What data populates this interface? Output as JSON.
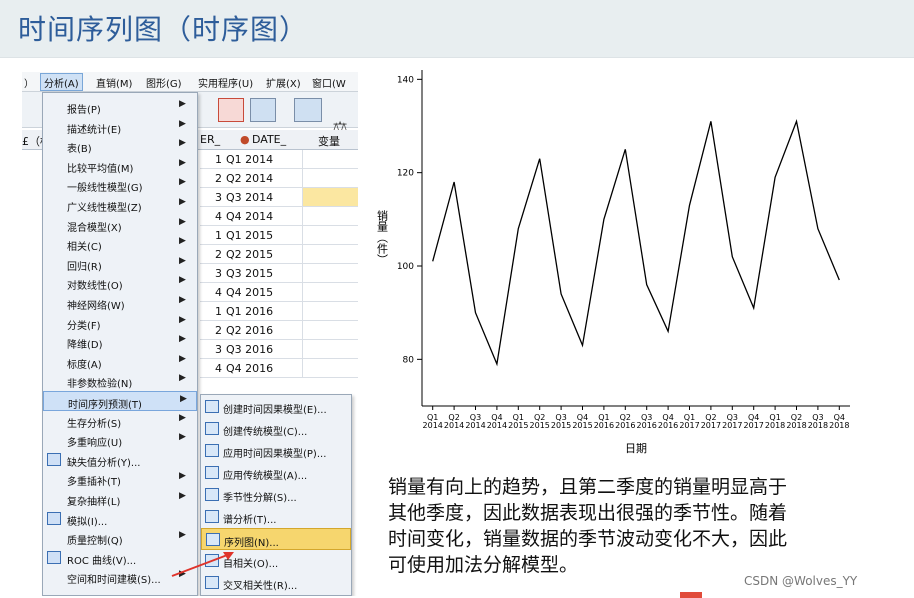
{
  "slide": {
    "title": "时间序列图（时序图）",
    "title_color": "#2e5d9a",
    "watermark": "CSDN @Wolves_YY",
    "description": [
      "销量有向上的趋势，且第二季度的销量明显高于",
      "其他季度，因此数据表现出很强的季节性。随着",
      "时间变化，销量数据的季节波动变化不大，因此",
      "可使用加法分解模型。"
    ]
  },
  "spss": {
    "menubar": [
      {
        "label": "）",
        "icon": "menu-fragment"
      },
      {
        "label": "分析(A)",
        "active": true
      },
      {
        "label": "直销(M)"
      },
      {
        "label": "图形(G)"
      },
      {
        "label": "实用程序(U)"
      },
      {
        "label": "扩展(X)"
      },
      {
        "label": "窗口(W"
      }
    ],
    "grid_headers": {
      "left_fragment": "£（标",
      "er": "ER_",
      "date": "DATE_",
      "var": "变量"
    },
    "rows": [
      {
        "n": "1",
        "date": "Q1 2014"
      },
      {
        "n": "2",
        "date": "Q2 2014"
      },
      {
        "n": "3",
        "date": "Q3 2014"
      },
      {
        "n": "4",
        "date": "Q4 2014"
      },
      {
        "n": "1",
        "date": "Q1 2015"
      },
      {
        "n": "2",
        "date": "Q2 2015"
      },
      {
        "n": "3",
        "date": "Q3 2015"
      },
      {
        "n": "4",
        "date": "Q4 2015"
      },
      {
        "n": "1",
        "date": "Q1 2016"
      },
      {
        "n": "2",
        "date": "Q2 2016"
      },
      {
        "n": "3",
        "date": "Q3 2016"
      },
      {
        "n": "4",
        "date": "Q4 2016"
      }
    ],
    "analyze_menu": [
      {
        "label": "报告(P)",
        "arrow": true
      },
      {
        "label": "描述统计(E)",
        "arrow": true
      },
      {
        "label": "表(B)",
        "arrow": true
      },
      {
        "label": "比较平均值(M)",
        "arrow": true
      },
      {
        "label": "一般线性模型(G)",
        "arrow": true
      },
      {
        "label": "广义线性模型(Z)",
        "arrow": true
      },
      {
        "label": "混合模型(X)",
        "arrow": true
      },
      {
        "label": "相关(C)",
        "arrow": true
      },
      {
        "label": "回归(R)",
        "arrow": true
      },
      {
        "label": "对数线性(O)",
        "arrow": true
      },
      {
        "label": "神经网络(W)",
        "arrow": true
      },
      {
        "label": "分类(F)",
        "arrow": true
      },
      {
        "label": "降维(D)",
        "arrow": true
      },
      {
        "label": "标度(A)",
        "arrow": true
      },
      {
        "label": "非参数检验(N)",
        "arrow": true
      },
      {
        "label": "时间序列预测(T)",
        "arrow": true,
        "highlight": true
      },
      {
        "label": "生存分析(S)",
        "arrow": true
      },
      {
        "label": "多重响应(U)",
        "arrow": true
      },
      {
        "label": "缺失值分析(Y)...",
        "icon": "missing-value-icon"
      },
      {
        "label": "多重插补(T)",
        "arrow": true
      },
      {
        "label": "复杂抽样(L)",
        "arrow": true
      },
      {
        "label": "模拟(I)...",
        "icon": "simulation-icon"
      },
      {
        "label": "质量控制(Q)",
        "arrow": true
      },
      {
        "label": "ROC 曲线(V)...",
        "icon": "roc-icon"
      },
      {
        "label": "空间和时间建模(S)...",
        "arrow": true
      }
    ],
    "ts_submenu": [
      {
        "label": "创建时间因果模型(E)...",
        "icon": "causal-model-icon"
      },
      {
        "label": "创建传统模型(C)...",
        "icon": "traditional-model-icon"
      },
      {
        "label": "应用时间因果模型(P)...",
        "icon": "apply-causal-icon"
      },
      {
        "label": "应用传统模型(A)...",
        "icon": "apply-traditional-icon"
      },
      {
        "label": "季节性分解(S)...",
        "icon": "seasonal-icon"
      },
      {
        "label": "谱分析(T)...",
        "icon": "spectral-icon"
      },
      {
        "label": "序列图(N)...",
        "icon": "sequence-chart-icon",
        "highlight": true
      },
      {
        "label": "自相关(O)...",
        "icon": "autocorrelation-icon"
      },
      {
        "label": "交叉相关性(R)...",
        "icon": "cross-correlation-icon"
      }
    ]
  },
  "chart_data": {
    "type": "line",
    "xlabel": "日期",
    "ylabel": "销量（件）",
    "ylim": [
      70,
      142
    ],
    "yticks": [
      80,
      100,
      120,
      140
    ],
    "grid": false,
    "categories": [
      "Q1 2014",
      "Q2 2014",
      "Q3 2014",
      "Q4 2014",
      "Q1 2015",
      "Q2 2015",
      "Q3 2015",
      "Q4 2015",
      "Q1 2016",
      "Q2 2016",
      "Q3 2016",
      "Q4 2016",
      "Q1 2017",
      "Q2 2017",
      "Q3 2017",
      "Q4 2017",
      "Q1 2018",
      "Q2 2018",
      "Q3 2018",
      "Q4 2018"
    ],
    "tick_top": [
      "Q1",
      "Q2",
      "Q3",
      "Q4",
      "Q1",
      "Q2",
      "Q3",
      "Q4",
      "Q1",
      "Q2",
      "Q3",
      "Q4",
      "Q1",
      "Q2",
      "Q3",
      "Q4",
      "Q1",
      "Q2",
      "Q3",
      "Q4"
    ],
    "tick_bottom": [
      "2014",
      "2014",
      "2014",
      "2014",
      "2015",
      "2015",
      "2015",
      "2015",
      "2016",
      "2016",
      "2016",
      "2016",
      "2017",
      "2017",
      "2017",
      "2017",
      "2018",
      "2018",
      "2018",
      "2018"
    ],
    "values": [
      101,
      118,
      90,
      79,
      108,
      123,
      94,
      83,
      110,
      125,
      96,
      86,
      113,
      131,
      102,
      91,
      119,
      131,
      108,
      97
    ],
    "line_color": "#000000"
  }
}
